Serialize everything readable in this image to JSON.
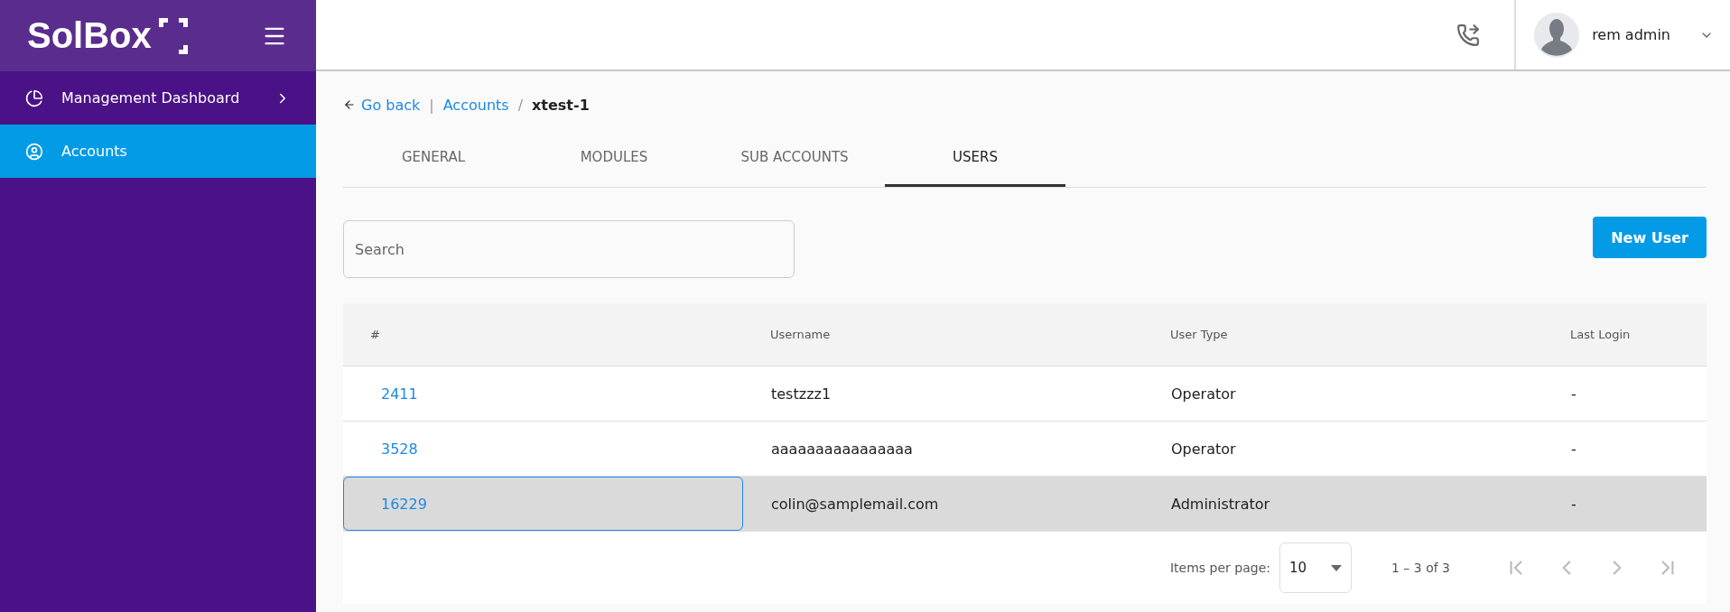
{
  "sidebar": {
    "logo": "SolBox",
    "items": [
      {
        "label": "Management Dashboard",
        "kind": "dashboard",
        "has_submenu": true,
        "selected": false
      },
      {
        "label": "Accounts",
        "kind": "account",
        "has_submenu": false,
        "selected": true
      }
    ]
  },
  "header": {
    "user_name": "rem admin"
  },
  "breadcrumb": {
    "back": "Go back",
    "separator_1": "|",
    "parent": "Accounts",
    "separator_2": "/",
    "current": "xtest-1"
  },
  "tabs": [
    {
      "label": "GENERAL",
      "selected": false
    },
    {
      "label": "MODULES",
      "selected": false
    },
    {
      "label": "SUB ACCOUNTS",
      "selected": false
    },
    {
      "label": "USERS",
      "selected": true
    }
  ],
  "search": {
    "placeholder": "Search"
  },
  "new_button": "New User",
  "table": {
    "columns": [
      "#",
      "Username",
      "User Type",
      "Last Login"
    ],
    "rows": [
      {
        "id": "2411",
        "username": "testzzz1",
        "user_type": "Operator",
        "last_login": "-",
        "selected": false
      },
      {
        "id": "3528",
        "username": "aaaaaaaaaaaaaaaa",
        "user_type": "Operator",
        "last_login": "-",
        "selected": false
      },
      {
        "id": "16229",
        "username": "colin@samplemail.com",
        "user_type": "Administrator",
        "last_login": "-",
        "selected": true
      }
    ]
  },
  "pagination": {
    "items_label": "Items per page:",
    "page_size": "10",
    "range": "1 – 3 of 3"
  }
}
